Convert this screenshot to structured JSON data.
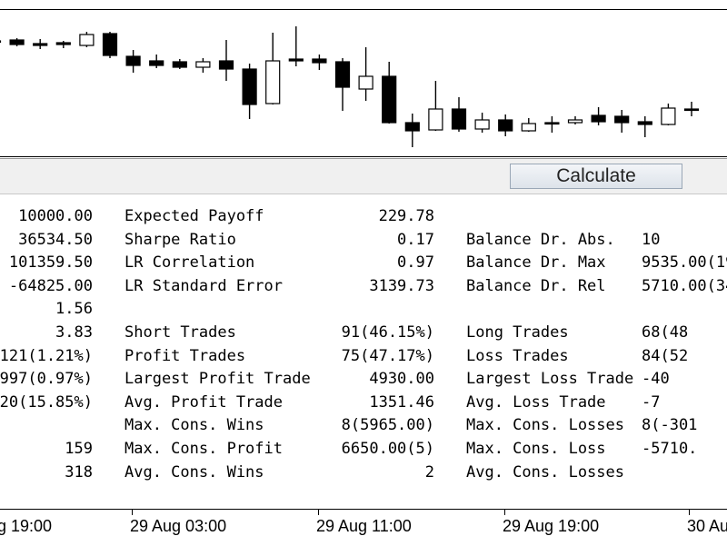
{
  "toolbar": {
    "calculate_label": "Calculate"
  },
  "report": {
    "col1_values": [
      "10000.00",
      "36534.50",
      "101359.50",
      "-64825.00",
      "1.56",
      "3.83",
      "121(1.21%)",
      "997(0.97%)",
      "20(15.85%)",
      "",
      "159",
      "318"
    ],
    "col2_labels": [
      "Expected Payoff",
      "Sharpe Ratio",
      "LR Correlation",
      "LR Standard Error",
      "",
      "Short Trades",
      "Profit Trades",
      "Largest Profit Trade",
      "Avg. Profit Trade",
      "Max. Cons. Wins",
      "Max. Cons. Profit",
      "Avg. Cons. Wins"
    ],
    "col3_values": [
      "229.78",
      "0.17",
      "0.97",
      "3139.73",
      "",
      "91(46.15%)",
      "75(47.17%)",
      "4930.00",
      "1351.46",
      "8(5965.00)",
      "6650.00(5)",
      "2"
    ],
    "col4_labels": [
      "",
      "Balance Dr. Abs.",
      "Balance Dr. Max",
      "Balance Dr. Rel",
      "",
      "Long Trades",
      "Loss Trades",
      "Largest Loss Trade",
      "Avg. Loss Trade",
      "Max. Cons. Losses",
      "Max. Cons. Loss",
      "Avg. Cons. Losses"
    ],
    "col5_values": [
      "",
      "10",
      "9535.00(19",
      "5710.00(34",
      "",
      "68(48",
      "84(52",
      "-40",
      "-7",
      "8(-301",
      "-5710.",
      ""
    ]
  },
  "time_axis": {
    "labels": [
      "g 19:00",
      "29 Aug 03:00",
      "29 Aug 11:00",
      "29 Aug 19:00",
      "30 Au"
    ]
  },
  "chart_data": {
    "type": "candlestick",
    "bullish_color": "#ffffff",
    "bearish_color": "#000000",
    "candles": [
      {
        "o": 45,
        "c": 45,
        "h": 40,
        "l": 52
      },
      {
        "o": 44,
        "c": 49,
        "h": 42,
        "l": 51
      },
      {
        "o": 48,
        "c": 50,
        "h": 43,
        "l": 54
      },
      {
        "o": 47,
        "c": 49,
        "h": 45,
        "l": 53
      },
      {
        "o": 50,
        "c": 38,
        "h": 35,
        "l": 52
      },
      {
        "o": 37,
        "c": 61,
        "h": 35,
        "l": 64
      },
      {
        "o": 62,
        "c": 72,
        "h": 55,
        "l": 80
      },
      {
        "o": 67,
        "c": 72,
        "h": 60,
        "l": 75
      },
      {
        "o": 68,
        "c": 74,
        "h": 65,
        "l": 76
      },
      {
        "o": 74,
        "c": 68,
        "h": 64,
        "l": 80
      },
      {
        "o": 67,
        "c": 76,
        "h": 44,
        "l": 89
      },
      {
        "o": 76,
        "c": 115,
        "h": 70,
        "l": 131
      },
      {
        "o": 114,
        "c": 67,
        "h": 36,
        "l": 115
      },
      {
        "o": 65,
        "c": 67,
        "h": 29,
        "l": 73
      },
      {
        "o": 65,
        "c": 69,
        "h": 60,
        "l": 77
      },
      {
        "o": 68,
        "c": 96,
        "h": 64,
        "l": 122
      },
      {
        "o": 98,
        "c": 84,
        "h": 52,
        "l": 111
      },
      {
        "o": 84,
        "c": 135,
        "h": 68,
        "l": 136
      },
      {
        "o": 135,
        "c": 144,
        "h": 125,
        "l": 162
      },
      {
        "o": 143,
        "c": 120,
        "h": 89,
        "l": 144
      },
      {
        "o": 120,
        "c": 142,
        "h": 107,
        "l": 145
      },
      {
        "o": 142,
        "c": 132,
        "h": 124,
        "l": 146
      },
      {
        "o": 132,
        "c": 144,
        "h": 126,
        "l": 150
      },
      {
        "o": 144,
        "c": 136,
        "h": 130,
        "l": 145
      },
      {
        "o": 135,
        "c": 135,
        "h": 128,
        "l": 146
      },
      {
        "o": 135,
        "c": 132,
        "h": 128,
        "l": 137
      },
      {
        "o": 127,
        "c": 134,
        "h": 118,
        "l": 138
      },
      {
        "o": 128,
        "c": 135,
        "h": 121,
        "l": 146
      },
      {
        "o": 134,
        "c": 137,
        "h": 128,
        "l": 151
      },
      {
        "o": 137,
        "c": 119,
        "h": 114,
        "l": 138
      },
      {
        "o": 120,
        "c": 121,
        "h": 112,
        "l": 128
      }
    ]
  }
}
